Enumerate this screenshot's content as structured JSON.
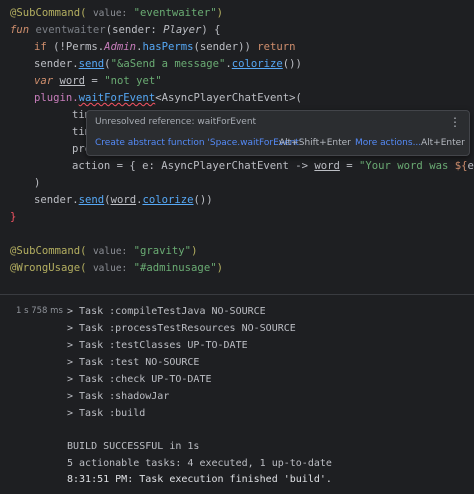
{
  "editor": {
    "line1": {
      "annotation": "@SubCommand(",
      "hint": "value:",
      "value": "\"eventwaiter\"",
      "close": ")"
    },
    "line2": {
      "kw": "fun",
      "name": "eventwaiter",
      "params": "(sender: ",
      "type": "Player",
      "close": ") {"
    },
    "line3": {
      "kw": "if",
      "pre": " (!Perms.",
      "obj": "Admin",
      "dot": ".",
      "fn": "hasPerms",
      "args": "(sender)) ",
      "ret": "return"
    },
    "line4": {
      "pre": "sender.",
      "fn": "send",
      "open": "(",
      "str": "\"&aSend a message\"",
      "dot": ".",
      "fn2": "colorize",
      "close": "())"
    },
    "line5": {
      "kw": "var",
      "name": "word",
      "eq": " = ",
      "str": "\"not yet\""
    },
    "line6": {
      "pre": "plugin.",
      "fn": "waitForEvent",
      "rest": "<AsyncPlayerChatEvent>("
    },
    "line7": "tim",
    "line8": "tim",
    "line9": "pre",
    "line10": {
      "pre": "action = { e: AsyncPlayerChatEvent -> ",
      "var": "word",
      "eq": " = ",
      "str1": "\"Your word was ",
      "tmpl": "${",
      "expr": "e.",
      "prop": "message",
      "tmpl_close": "}",
      "str2": ".\"",
      "close": " }"
    },
    "line11": ")",
    "line12": {
      "pre": "sender.",
      "fn": "send",
      "open": "(",
      "var": "word",
      "dot": ".",
      "fn2": "colorize",
      "close": "())"
    },
    "line13": "}",
    "line14": {
      "annotation": "@SubCommand(",
      "hint": "value:",
      "value": "\"gravity\"",
      "close": ")"
    },
    "line15": {
      "annotation": "@WrongUsage(",
      "hint": "value:",
      "value": "\"#adminusage\"",
      "close": ")"
    }
  },
  "popup": {
    "message": "Unresolved reference: waitForEvent",
    "more_icon": "⋮",
    "fix_label": "Create abstract function 'Space.waitForEvent'",
    "fix_shortcut": "Alt+Shift+Enter",
    "more_actions_label": "More actions...",
    "more_actions_shortcut": "Alt+Enter"
  },
  "console": {
    "duration": "1 s 758 ms",
    "tasks": [
      "> Task :compileTestJava NO-SOURCE",
      "> Task :processTestResources NO-SOURCE",
      "> Task :testClasses UP-TO-DATE",
      "> Task :test NO-SOURCE",
      "> Task :check UP-TO-DATE",
      "> Task :shadowJar",
      "> Task :build"
    ],
    "build_result": "BUILD SUCCESSFUL in 1s",
    "actionable": "5 actionable tasks: 4 executed, 1 up-to-date",
    "finish_time": "8:31:51 PM: Task execution finished 'build'."
  }
}
